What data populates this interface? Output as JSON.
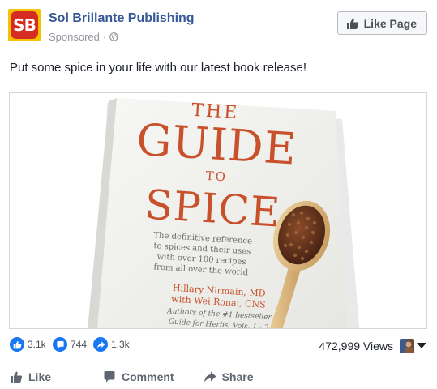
{
  "header": {
    "logo_text": "SB",
    "page_name": "Sol Brillante Publishing",
    "sponsored_label": "Sponsored",
    "separator": "·",
    "like_page_label": "Like Page"
  },
  "post": {
    "text": "Put some spice in your life with our latest book release!"
  },
  "media": {
    "book_title_line1": "THE",
    "book_title_line2": "GUIDE",
    "book_title_line3": "TO",
    "book_title_line4": "SPICE",
    "tagline_line1": "The definitive reference",
    "tagline_line2": "to spices and their uses",
    "tagline_line3": "with over 100 recipes",
    "tagline_line4": "from all over the world",
    "author_line1": "Hillary Nirmain, MD",
    "author_line2": "with Wei Ronai, CNS",
    "author_line3": "Authors of the #1 bestseller",
    "author_line4": "Guide for Herbs, Vols. 1 - 3"
  },
  "reactions": {
    "likes": "3.1k",
    "comments": "744",
    "shares": "1.3k",
    "views": "472,999 Views"
  },
  "actions": {
    "like": "Like",
    "comment": "Comment",
    "share": "Share"
  },
  "colors": {
    "page_link": "#365899",
    "reaction_blue": "#1877f2",
    "book_title": "#c8502a"
  }
}
